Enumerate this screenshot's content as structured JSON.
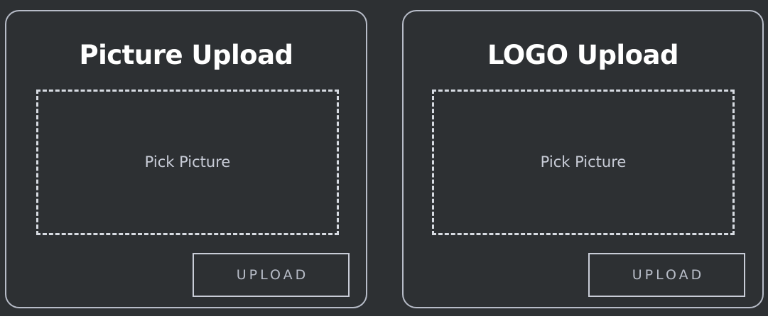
{
  "cards": [
    {
      "title": "Picture Upload",
      "drop_zone_label": "Pick Picture",
      "button_label": "UPLOAD"
    },
    {
      "title": "LOGO Upload",
      "drop_zone_label": "Pick Picture",
      "button_label": "UPLOAD"
    }
  ],
  "colors": {
    "background": "#2d3033",
    "card_border": "#b7bcc8",
    "dashed_border": "#d7dbe2",
    "title_text": "#ffffff",
    "muted_text": "#c8ccd7"
  }
}
